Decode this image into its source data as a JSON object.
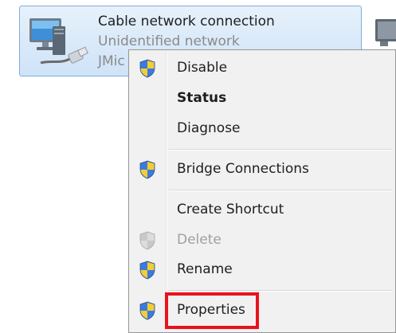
{
  "connection": {
    "name": "Cable network connection",
    "status": "Unidentified network",
    "adapter": "JMic"
  },
  "context_menu": {
    "items": [
      {
        "label": "Disable",
        "icon": "uac-shield-icon",
        "bold": false,
        "disabled": false
      },
      {
        "label": "Status",
        "icon": null,
        "bold": true,
        "disabled": false
      },
      {
        "label": "Diagnose",
        "icon": null,
        "bold": false,
        "disabled": false
      },
      {
        "label": "Bridge Connections",
        "icon": "uac-shield-icon",
        "bold": false,
        "disabled": false
      },
      {
        "label": "Create Shortcut",
        "icon": null,
        "bold": false,
        "disabled": false
      },
      {
        "label": "Delete",
        "icon": "uac-shield-icon",
        "bold": false,
        "disabled": true
      },
      {
        "label": "Rename",
        "icon": "uac-shield-icon",
        "bold": false,
        "disabled": false
      },
      {
        "label": "Properties",
        "icon": "uac-shield-icon",
        "bold": false,
        "disabled": false
      }
    ]
  },
  "highlight": {
    "target": "Properties",
    "color": "#e8121d"
  },
  "colors": {
    "tile_selected": "#cfe3f8",
    "menu_background": "#f1f1f1",
    "disabled_text": "#a0a0a0"
  }
}
